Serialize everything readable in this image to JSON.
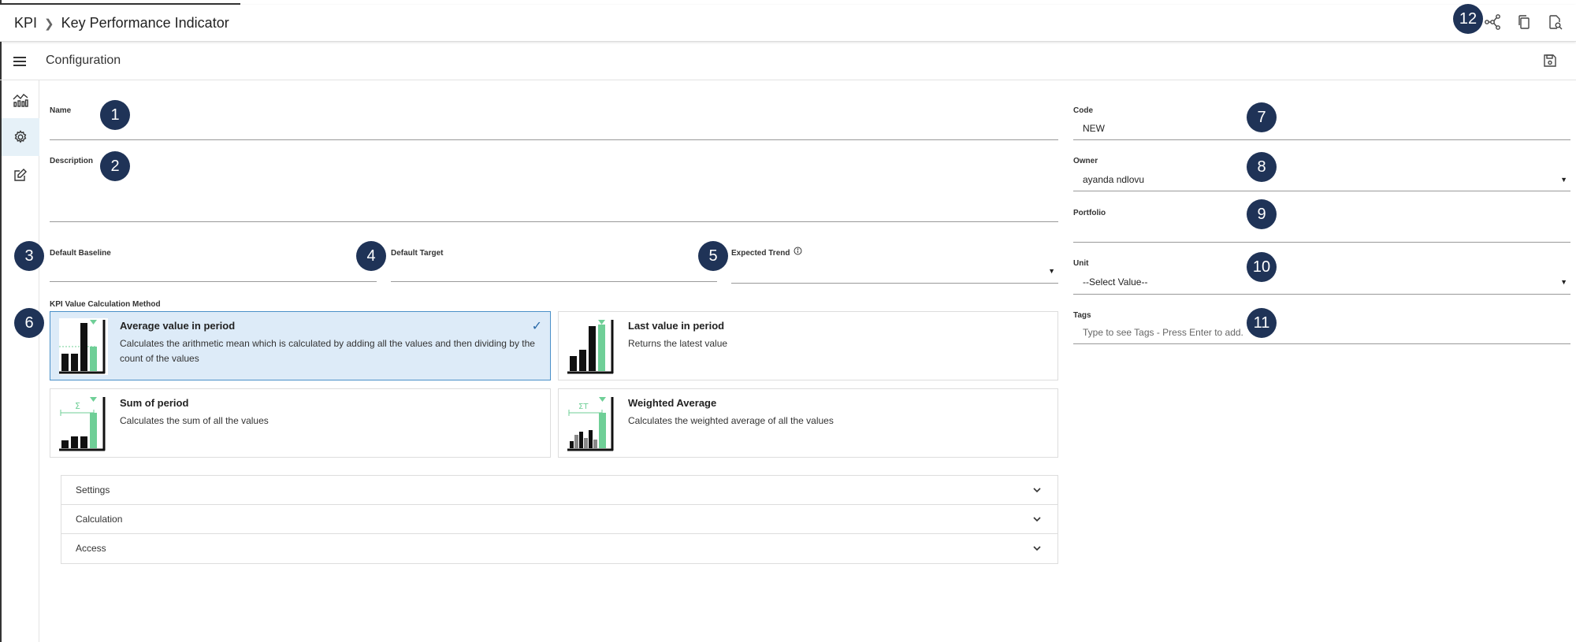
{
  "header": {
    "breadcrumb_root": "KPI",
    "breadcrumb_current": "Key Performance Indicator"
  },
  "subheader": {
    "title": "Configuration"
  },
  "badges": [
    "1",
    "2",
    "3",
    "4",
    "5",
    "6",
    "7",
    "8",
    "9",
    "10",
    "11",
    "12"
  ],
  "fields": {
    "name": {
      "label": "Name",
      "value": ""
    },
    "description": {
      "label": "Description",
      "value": ""
    },
    "default_baseline": {
      "label": "Default Baseline",
      "value": ""
    },
    "default_target": {
      "label": "Default Target",
      "value": ""
    },
    "expected_trend": {
      "label": "Expected Trend",
      "value": ""
    },
    "calc_method": {
      "label": "KPI Value Calculation Method"
    },
    "code": {
      "label": "Code",
      "value": "NEW"
    },
    "owner": {
      "label": "Owner",
      "value": "ayanda ndlovu"
    },
    "portfolio": {
      "label": "Portfolio",
      "value": ""
    },
    "unit": {
      "label": "Unit",
      "value": "--Select Value--"
    },
    "tags": {
      "label": "Tags",
      "placeholder": "Type to see Tags - Press Enter to add."
    }
  },
  "methods": [
    {
      "title": "Average value in period",
      "desc": "Calculates the arithmetic mean which is calculated by adding all the values and then dividing by the count of the values",
      "selected": true
    },
    {
      "title": "Last value in period",
      "desc": "Returns the latest value",
      "selected": false
    },
    {
      "title": "Sum of period",
      "desc": "Calculates the sum of all the values",
      "selected": false
    },
    {
      "title": "Weighted Average",
      "desc": "Calculates the weighted average of all the values",
      "selected": false
    }
  ],
  "thumb_labels": {
    "sum": "Σ",
    "weighted": "ΣT"
  },
  "accordion": [
    {
      "label": "Settings"
    },
    {
      "label": "Calculation"
    },
    {
      "label": "Access"
    }
  ],
  "colors": {
    "accent": "#1f3357",
    "selected_bg": "#ddebf8",
    "bar_green": "#6fcf97"
  },
  "icons": [
    "network-icon",
    "copy-icon",
    "search-document-icon",
    "menu-icon",
    "save-icon",
    "chart-icon",
    "gear-icon",
    "edit-icon",
    "info-icon",
    "check-icon",
    "chevron-down-icon"
  ]
}
